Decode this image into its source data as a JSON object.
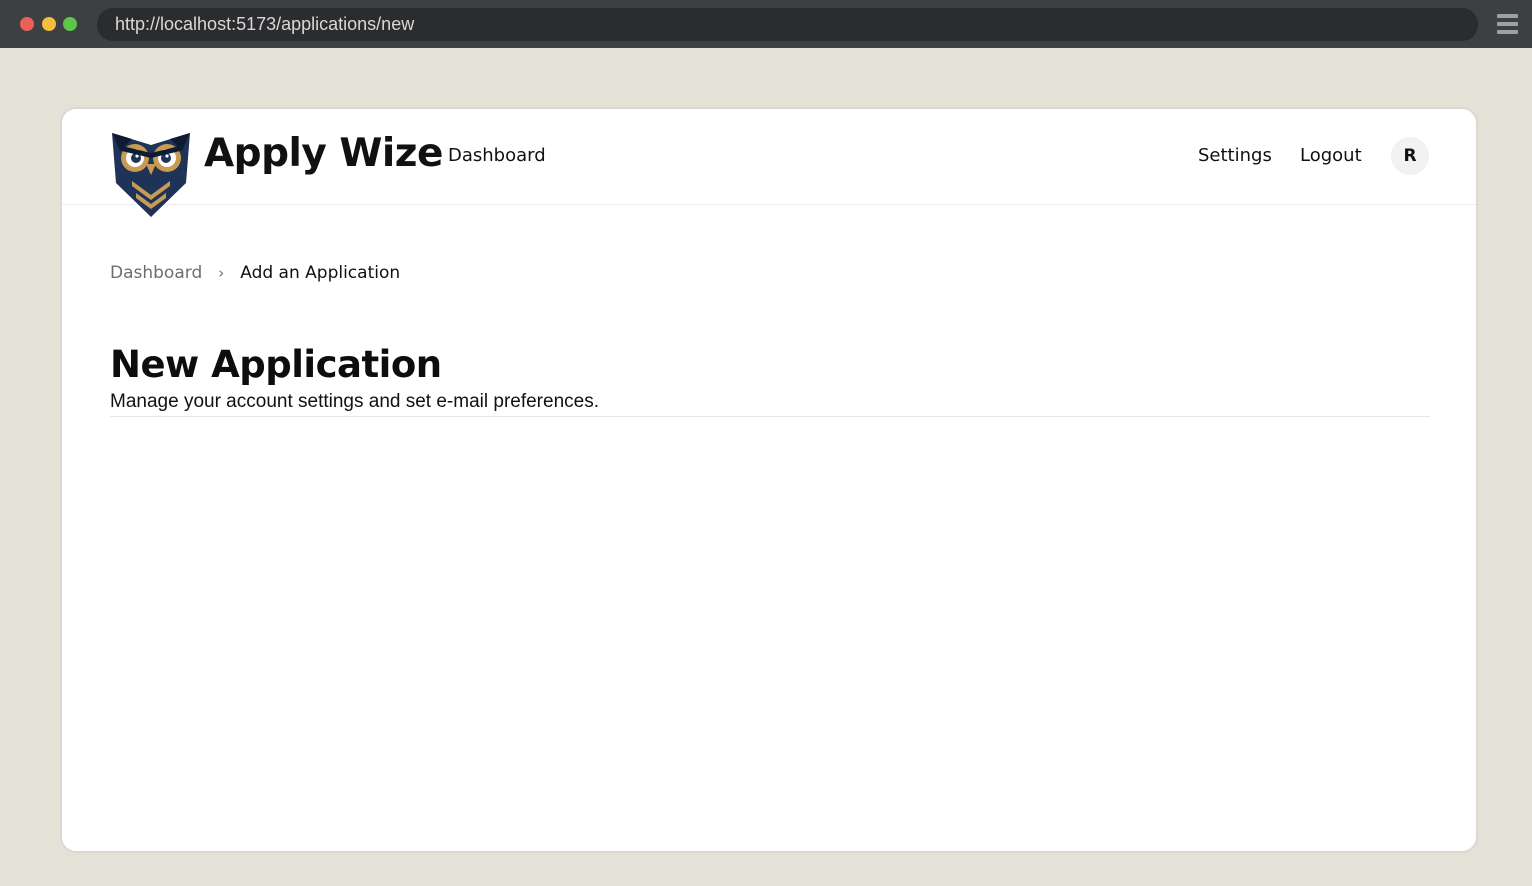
{
  "browser": {
    "url": "http://localhost:5173/applications/new"
  },
  "header": {
    "brand": "Apply Wize",
    "nav_dashboard": "Dashboard",
    "nav_settings": "Settings",
    "nav_logout": "Logout",
    "avatar_initial": "R"
  },
  "breadcrumb": {
    "root": "Dashboard",
    "separator": "›",
    "current": "Add an Application"
  },
  "main": {
    "title": "New Application",
    "subtitle": "Manage your account settings and set e-mail preferences."
  },
  "colors": {
    "page_background": "#e4e2d6",
    "owl_navy": "#1f3258",
    "owl_gold": "#c89b52"
  }
}
